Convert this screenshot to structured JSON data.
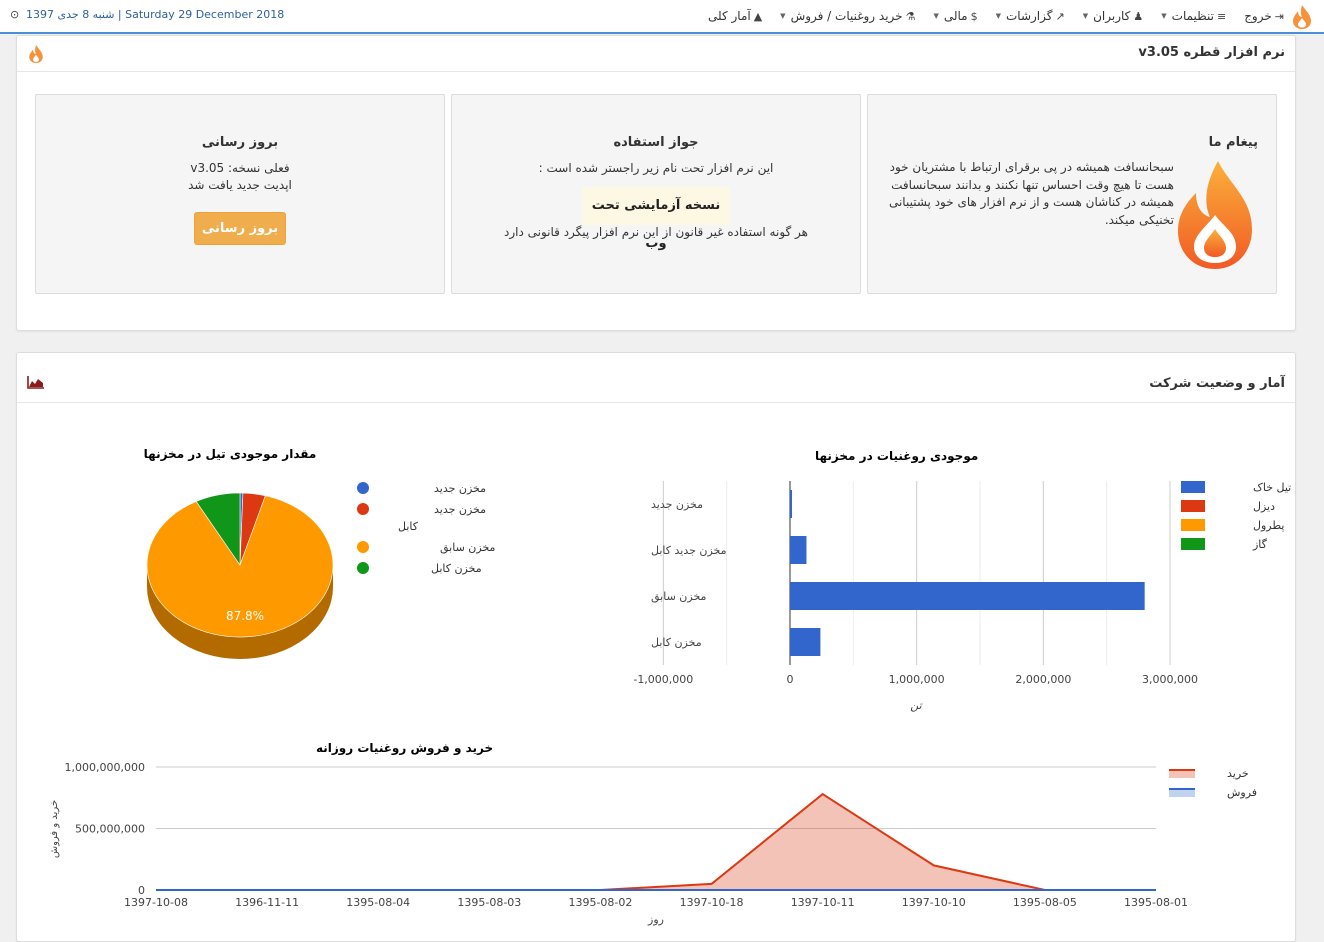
{
  "nav": {
    "items": [
      {
        "label": "آمار کلی",
        "icon": "area-chart-icon",
        "dropdown": false
      },
      {
        "label": "خرید روغنیات / فروش",
        "icon": "flask-icon",
        "dropdown": true
      },
      {
        "label": "مالی",
        "icon": "dollar-icon",
        "dropdown": true
      },
      {
        "label": "گزارشات",
        "icon": "line-chart-icon",
        "dropdown": true
      },
      {
        "label": "کاربران",
        "icon": "users-icon",
        "dropdown": true
      },
      {
        "label": "تنظیمات",
        "icon": "bars-icon",
        "dropdown": true
      },
      {
        "label": "خروج",
        "icon": "sign-out-icon",
        "dropdown": false
      }
    ],
    "date": "شنبه 8 جدی 1397 | Saturday 29 December 2018"
  },
  "software_panel": {
    "title": "نرم افزار قطره v3.05",
    "message": {
      "title": "پیغام ما",
      "text": "سبحانسافت همیشه در پی برقرای ارتباط با مشتریان خود هست تا هیچ وقت احساس تنها نکنند و بدانند سبحانسافت همیشه در کناشان هست و از نرم افزار های خود پشتیبانی تخنیکی میکند."
    },
    "license": {
      "title": "جواز استفاده",
      "line1": "این نرم افزار تحت نام زیر راجستر شده است :",
      "highlight": "نسخه آزمایشی تحت وب",
      "line2": "هر گونه استفاده غیر قانون از این نرم افزار پیگرد قانونی دارد"
    },
    "update": {
      "title": "بروز رسانی",
      "current_version": "فعلی نسخه: v3.05",
      "status": "اپدیت جدید یافت شد",
      "button_label": "بروز رسانی"
    }
  },
  "stats_panel": {
    "title": "آمار و وضعیت شرکت"
  },
  "colors": {
    "accent": "#4a90d9",
    "button": "#f0ad4e",
    "blue": "#3366cc",
    "red": "#dc3912",
    "orange": "#ff9900",
    "green": "#109618"
  },
  "chart_data": [
    {
      "type": "bar",
      "orientation": "horizontal",
      "title": "موجودی روغنیات در مخزنها",
      "xlabel": "تن",
      "categories": [
        "مخزن جدید",
        "مخزن جدید کابل",
        "مخزن سابق",
        "مخزن کابل"
      ],
      "series": [
        {
          "name": "تیل خاک",
          "color": "#3366cc",
          "values": [
            15000,
            130000,
            2800000,
            240000
          ]
        },
        {
          "name": "دیزل",
          "color": "#dc3912",
          "values": [
            0,
            0,
            0,
            0
          ]
        },
        {
          "name": "پطرول",
          "color": "#ff9900",
          "values": [
            0,
            0,
            0,
            0
          ]
        },
        {
          "name": "گاز",
          "color": "#109618",
          "values": [
            0,
            0,
            0,
            0
          ]
        }
      ],
      "xlim": [
        -1000000,
        3000000
      ],
      "ticks": [
        "-1,000,000",
        "0",
        "1,000,000",
        "2,000,000",
        "3,000,000"
      ],
      "tick_values": [
        -1000000,
        0,
        1000000,
        2000000,
        3000000
      ],
      "legend_position": "right"
    },
    {
      "type": "pie",
      "title": "مقدار موجودی تیل در مخزنها",
      "slices": [
        {
          "label": "مخزن جدید",
          "value": 0.5,
          "color": "#3366cc"
        },
        {
          "label": "مخزن جدید کابل",
          "value": 3.9,
          "color": "#dc3912"
        },
        {
          "label": "مخزن سابق",
          "value": 87.8,
          "color": "#ff9900"
        },
        {
          "label": "مخزن کابل",
          "value": 7.8,
          "color": "#109618"
        }
      ],
      "data_label": "87.8%",
      "legend_position": "right"
    },
    {
      "type": "area",
      "title": "خرید و فروش روغنیات روزانه",
      "xlabel": "روز",
      "ylabel": "خرید و فروش",
      "categories": [
        "1397-10-08",
        "1396-11-11",
        "1395-08-04",
        "1395-08-03",
        "1395-08-02",
        "1397-10-18",
        "1397-10-11",
        "1397-10-10",
        "1395-08-05",
        "1395-08-01"
      ],
      "series": [
        {
          "name": "خرید",
          "color": "#dc3912",
          "values": [
            0,
            0,
            0,
            0,
            0,
            50000000,
            780000000,
            200000000,
            0,
            0
          ]
        },
        {
          "name": "فروش",
          "color": "#3366cc",
          "values": [
            0,
            0,
            0,
            0,
            0,
            0,
            0,
            0,
            0,
            0
          ]
        }
      ],
      "ylim": [
        0,
        1000000000
      ],
      "yticks": [
        "0",
        "500,000,000",
        "1,000,000,000"
      ],
      "ytick_values": [
        0,
        500000000,
        1000000000
      ],
      "legend_position": "right"
    }
  ]
}
